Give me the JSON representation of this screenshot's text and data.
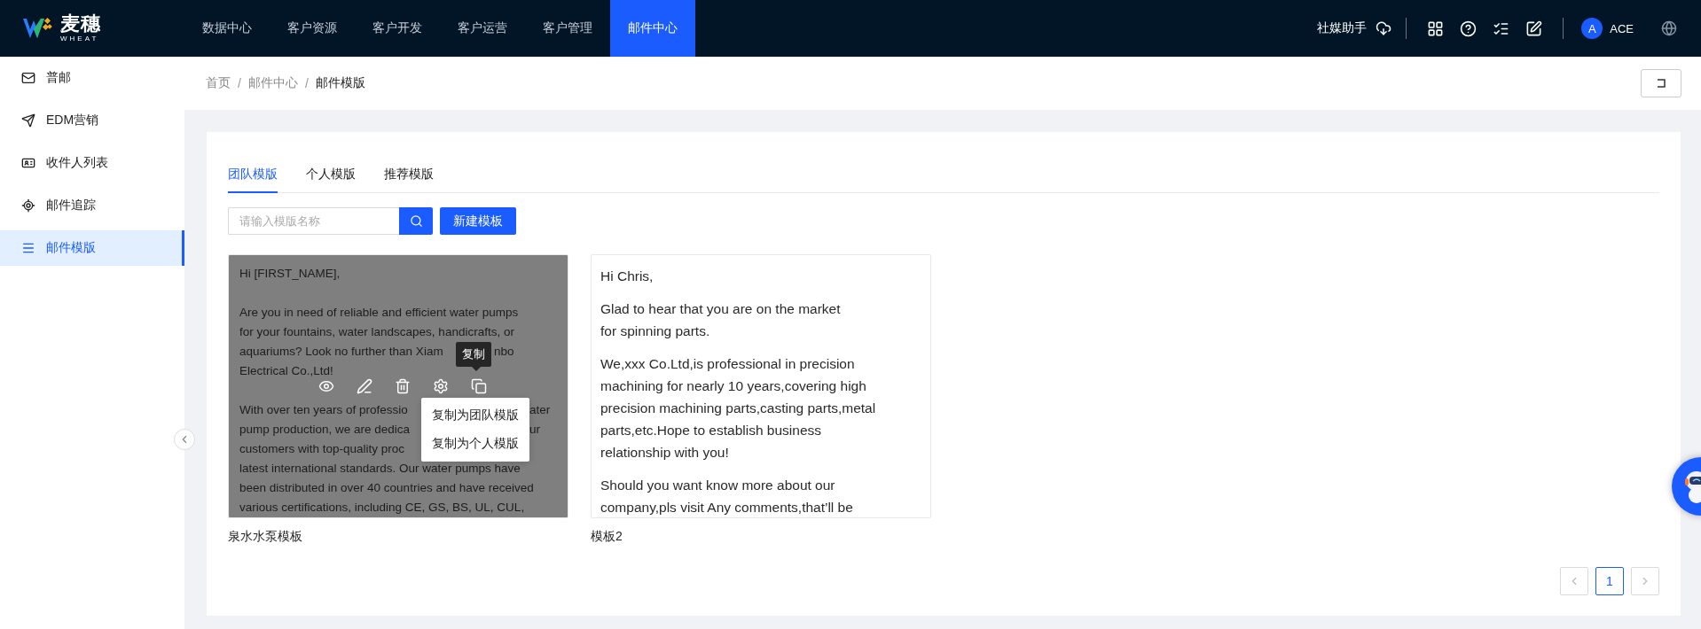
{
  "logo": {
    "name": "麦穗",
    "subtitle": "WHEAT"
  },
  "top_nav": [
    {
      "label": "数据中心",
      "selected": false
    },
    {
      "label": "客户资源",
      "selected": false
    },
    {
      "label": "客户开发",
      "selected": false
    },
    {
      "label": "客户运营",
      "selected": false
    },
    {
      "label": "客户管理",
      "selected": false
    },
    {
      "label": "邮件中心",
      "selected": true
    }
  ],
  "header_right": {
    "assistant": "社媒助手",
    "avatar_initial": "A",
    "user": "ACE"
  },
  "sidebar": {
    "items": [
      {
        "label": "普邮",
        "selected": false
      },
      {
        "label": "EDM营销",
        "selected": false
      },
      {
        "label": "收件人列表",
        "selected": false
      },
      {
        "label": "邮件追踪",
        "selected": false
      },
      {
        "label": "邮件模版",
        "selected": true
      }
    ]
  },
  "breadcrumb": [
    {
      "label": "首页"
    },
    {
      "separator": "/",
      "label": "邮件中心"
    },
    {
      "separator": "/",
      "label": "邮件模版"
    }
  ],
  "tabs": [
    {
      "label": "团队模版",
      "selected": true
    },
    {
      "label": "个人模版",
      "selected": false
    },
    {
      "label": "推荐模版",
      "selected": false
    }
  ],
  "search": {
    "placeholder": "请输入模版名称"
  },
  "new_button": "新建模板",
  "templates": [
    {
      "name": "泉水水泵模板",
      "hovered": true,
      "tooltip": "复制",
      "menu": [
        "复制为团队模版",
        "复制为个人模版"
      ],
      "paragraphs": [
        [
          "Hi [FIRST_NAME],"
        ],
        [
          "Are you in need of reliable and efficient water pumps",
          "for your fountains, water landscapes, handicrafts, or",
          {
            "left": "aquariums? Look no further than Xiam",
            "right": "nbo"
          },
          "Electrical Co.,Ltd!"
        ],
        [
          {
            "left": "With over ten years of professio",
            "right": "ater"
          },
          {
            "left": "pump production, we are dedica",
            "right": "ur"
          },
          {
            "left": "customers with top-quality proc"
          },
          "latest international standards. Our water pumps have",
          "been distributed in over 40 countries and have received",
          "various certifications, including CE, GS, BS, UL, CUL,"
        ]
      ]
    },
    {
      "name": "模板2",
      "hovered": false,
      "paragraphs": [
        [
          "Hi Chris,"
        ],
        [
          "Glad to hear that you are on the market",
          "for spinning parts."
        ],
        [
          "We,xxx Co.Ltd,is professional in precision",
          "machining for nearly 10 years,covering high",
          "precision machining parts,casting parts,metal",
          "parts,etc.Hope to establish business",
          "relationship with you!"
        ],
        [
          "Should you want know more about our",
          "company,pls visit Any comments,that’ll be"
        ]
      ]
    }
  ],
  "pagination": {
    "pages": [
      {
        "label": "1",
        "selected": true
      }
    ]
  }
}
